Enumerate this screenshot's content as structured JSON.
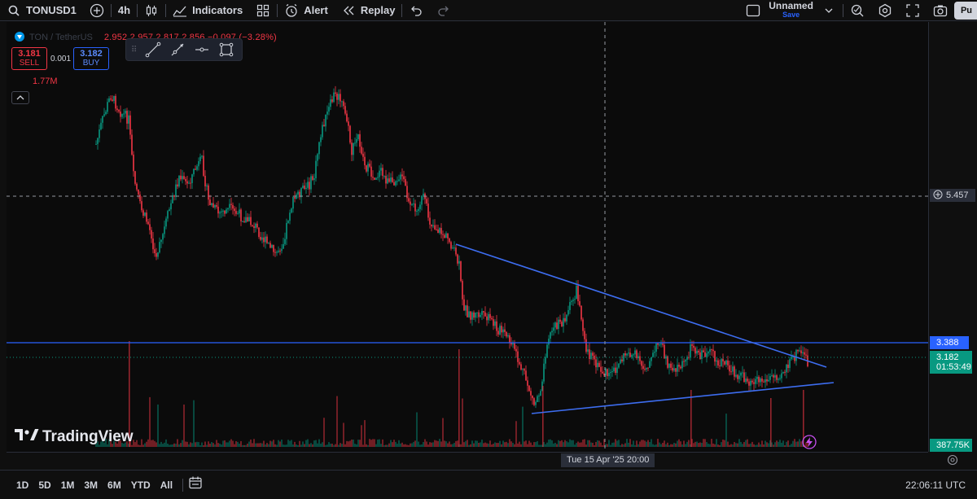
{
  "toolbar": {
    "symbol": "TONUSD1",
    "interval": "4h",
    "indicators_label": "Indicators",
    "alert_label": "Alert",
    "replay_label": "Replay",
    "layout_name": "Unnamed",
    "save_label": "Save",
    "publish_label": "Pu"
  },
  "legend": {
    "symbol_text": "TON / TetherUS",
    "values_text": "2.952   2.957   2.817   2.856  −0.097 (−3.28%)",
    "sell_price": "3.181",
    "sell_label": "SELL",
    "spread": "0.001",
    "buy_price": "3.182",
    "buy_label": "BUY",
    "volume_value": "1.77M"
  },
  "price_labels": {
    "crosshair": "5.457",
    "hline": "3.388",
    "current_price": "3.182",
    "countdown": "01:53:49",
    "volume": "387.75K"
  },
  "crosshair_time": "Tue 15 Apr '25   20:00",
  "brand": "TradingView",
  "bottom_bar": {
    "ranges": [
      "1D",
      "5D",
      "1M",
      "3M",
      "6M",
      "YTD",
      "All"
    ],
    "clock": "22:06:11 UTC"
  },
  "colors": {
    "up": "#089981",
    "down": "#f23645",
    "accent": "#2962ff",
    "trendline": "#3d6df0"
  },
  "icons": [
    "search-icon",
    "plus-circle-icon",
    "bar-style-icon",
    "indicators-icon",
    "templates-icon",
    "alert-icon",
    "replay-icon",
    "undo-icon",
    "redo-icon",
    "lens-icon",
    "settings-icon",
    "fullscreen-icon",
    "camera-icon",
    "lightning-icon",
    "calendar-range-icon"
  ]
}
